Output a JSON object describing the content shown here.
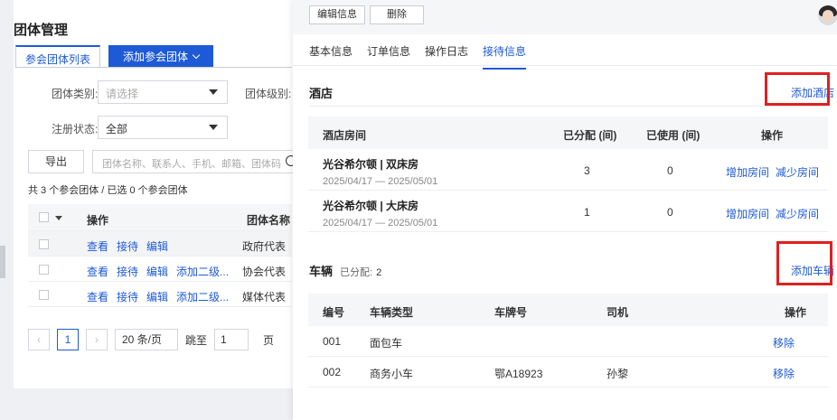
{
  "background": {
    "title": "团体管理",
    "tabs": {
      "list": "参会团体列表",
      "add": "添加参会团体"
    },
    "filters": {
      "type_label": "团体类别:",
      "type_placeholder": "请选择",
      "level_label": "团体级别:",
      "status_label": "注册状态:",
      "status_value": "全部"
    },
    "export_label": "导出",
    "search_placeholder": "团体名称、联系人、手机、邮箱、团体码",
    "count_text": "共 3 个参会团体 / 已选 0 个参会团体",
    "table": {
      "headers": {
        "op": "操作",
        "name": "团体名称"
      },
      "rows": [
        {
          "links": [
            "查看",
            "接待",
            "编辑"
          ],
          "name": "政府代表"
        },
        {
          "links": [
            "查看",
            "接待",
            "编辑",
            "添加二级..."
          ],
          "name": "协会代表"
        },
        {
          "links": [
            "查看",
            "接待",
            "编辑",
            "添加二级..."
          ],
          "name": "媒体代表"
        }
      ]
    },
    "pager": {
      "prev": "‹",
      "page": "1",
      "next": "›",
      "size": "20 条/页",
      "jump_label": "跳至",
      "jump_value": "1",
      "page_unit": "页"
    }
  },
  "drawer": {
    "buttons": {
      "edit": "编辑信息",
      "delete": "删除"
    },
    "tabs": [
      "基本信息",
      "订单信息",
      "操作日志",
      "接待信息"
    ],
    "active_tab": 3,
    "hotel": {
      "title": "酒店",
      "add_label": "添加酒店",
      "headers": {
        "room": "酒店房间",
        "allocated": "已分配 (间)",
        "used": "已使用 (间)",
        "op": "操作"
      },
      "rows": [
        {
          "name": "光谷希尔顿 | 双床房",
          "dates": "2025/04/17 — 2025/05/01",
          "allocated": "3",
          "used": "0",
          "add": "增加房间",
          "reduce": "减少房间"
        },
        {
          "name": "光谷希尔顿 | 大床房",
          "dates": "2025/04/17 — 2025/05/01",
          "allocated": "1",
          "used": "0",
          "add": "增加房间",
          "reduce": "减少房间"
        }
      ]
    },
    "vehicle": {
      "title": "车辆",
      "allocated_label": "已分配:",
      "allocated_value": "2",
      "add_label": "添加车辆",
      "headers": {
        "no": "编号",
        "type": "车辆类型",
        "plate": "车牌号",
        "driver": "司机",
        "op": "操作"
      },
      "rows": [
        {
          "no": "001",
          "type": "面包车",
          "plate": "",
          "driver": "",
          "op": "移除"
        },
        {
          "no": "002",
          "type": "商务小车",
          "plate": "鄂A18923",
          "driver": "孙黎",
          "op": "移除"
        }
      ]
    }
  },
  "colors": {
    "accent": "#1e5ad7",
    "highlight_box": "#e02020"
  }
}
